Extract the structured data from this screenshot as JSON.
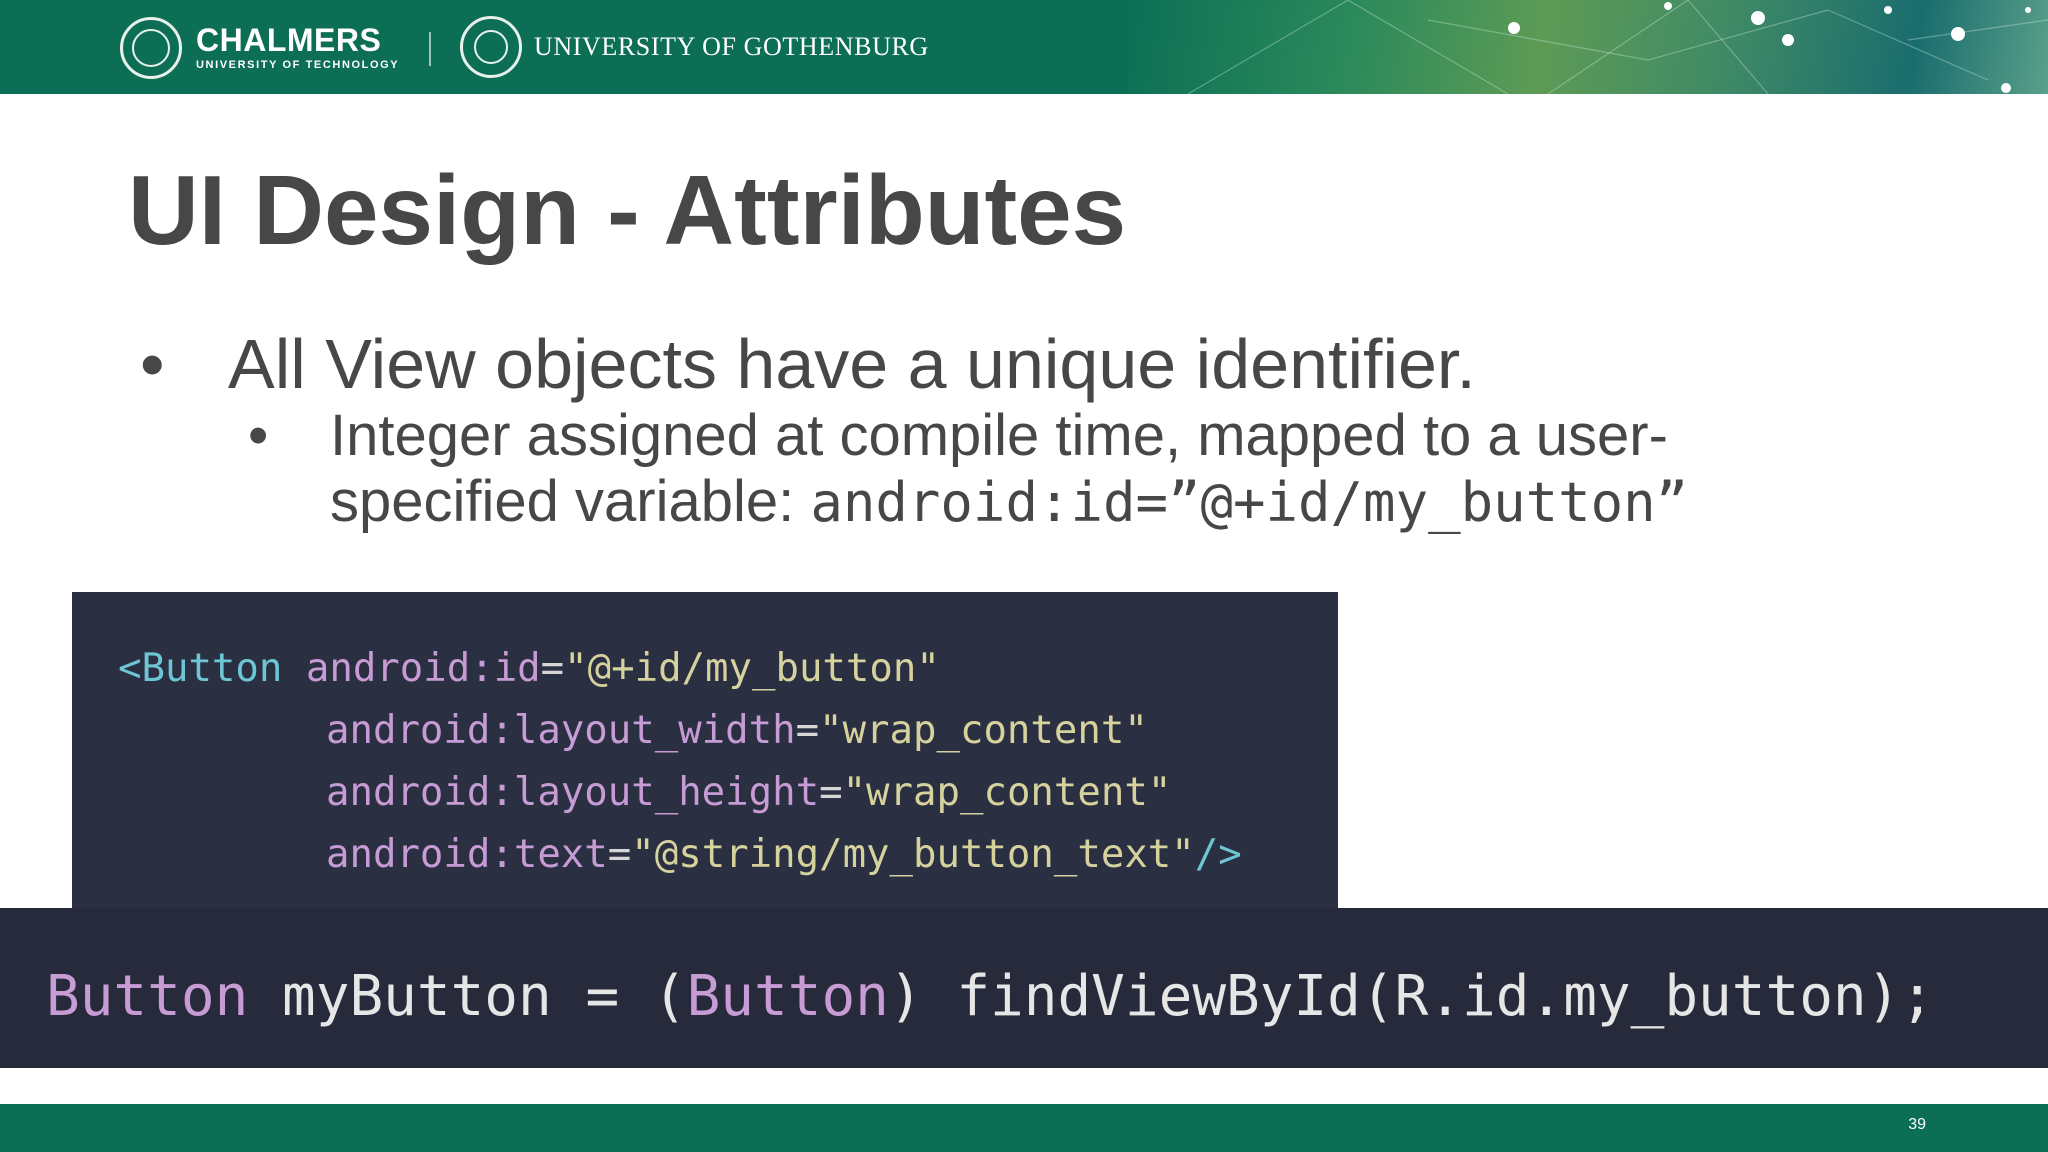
{
  "header": {
    "chalmers_name": "CHALMERS",
    "chalmers_sub": "UNIVERSITY OF TECHNOLOGY",
    "gu_name": "UNIVERSITY OF GOTHENBURG",
    "brand_color": "#0c6f55"
  },
  "slide": {
    "title": "UI Design - Attributes",
    "bullet1": "All View objects have a unique identifier.",
    "bullet2_text": "Integer assigned at compile time, mapped to a user-specified variable: ",
    "bullet2_code": "android:id=”@+id/my_button”",
    "bullet_glyph": "•"
  },
  "code_block_1": {
    "line1": {
      "tag": "<Button",
      "attr": "android:id",
      "eq": "=",
      "str": "\"@+id/my_button\""
    },
    "line2": {
      "attr": "android:layout_width",
      "eq": "=",
      "str": "\"wrap_content\""
    },
    "line3": {
      "attr": "android:layout_height",
      "eq": "=",
      "str": "\"wrap_content\""
    },
    "line4": {
      "attr": "android:text",
      "eq": "=",
      "str": "\"@string/my_button_text\"",
      "close": "/>"
    }
  },
  "code_block_2": {
    "type1": "Button",
    "rest1": " myButton = (",
    "type2": "Button",
    "rest2": ") findViewById(R.id.my_button);"
  },
  "footer": {
    "page_number": "39"
  }
}
